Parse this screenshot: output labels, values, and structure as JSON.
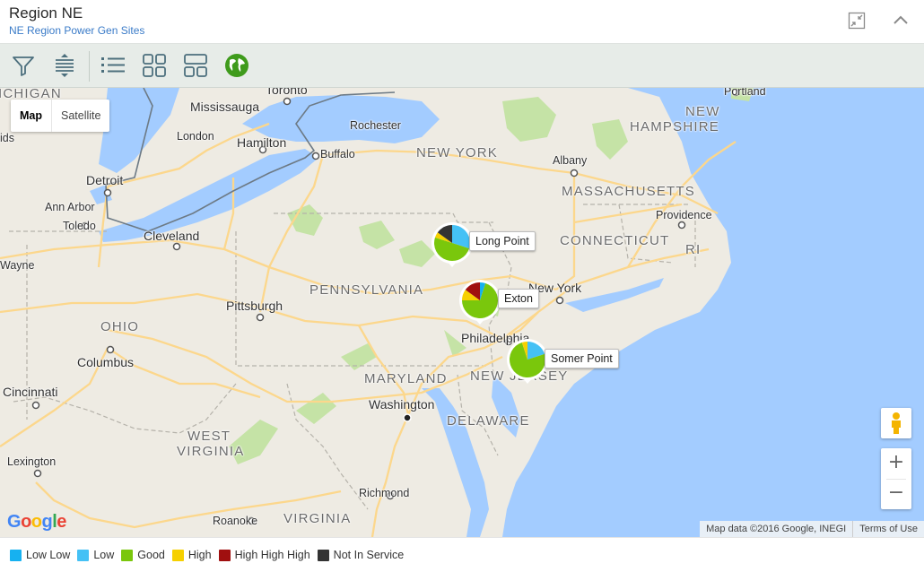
{
  "header": {
    "title": "Region NE",
    "subtitle": "NE Region Power Gen Sites"
  },
  "toolbar": {
    "buttons": [
      "filter-icon",
      "row-spacing-icon",
      "list-view-icon",
      "grid-view-icon",
      "split-view-icon",
      "globe-map-icon"
    ]
  },
  "map": {
    "map_type": {
      "map": "Map",
      "satellite": "Satellite"
    },
    "states": {
      "michigan": "ICHIGAN",
      "new_york": "NEW YORK",
      "massachusetts": "MASSACHUSETTS",
      "new_hampshire_1": "NEW",
      "new_hampshire_2": "HAMPSHIRE",
      "connecticut": "CONNECTICUT",
      "ri": "RI",
      "pennsylvania": "PENNSYLVANIA",
      "ohio": "OHIO",
      "maryland": "MARYLAND",
      "new_jersey": "NEW JERSEY",
      "delaware": "DELAWARE",
      "west_virginia_1": "WEST",
      "west_virginia_2": "VIRGINIA",
      "virginia": "VIRGINIA"
    },
    "cities": {
      "toronto": "Toronto",
      "mississauga": "Mississauga",
      "portland": "Portland",
      "rochester": "Rochester",
      "london": "London",
      "hamilton": "Hamilton",
      "buffalo": "Buffalo",
      "albany": "Albany",
      "ids": "ids",
      "detroit": "Detroit",
      "ann_arbor": "Ann Arbor",
      "toledo": "Toledo",
      "cleveland": "Cleveland",
      "providence": "Providence",
      "wayne": "Wayne",
      "pittsburgh": "Pittsburgh",
      "new_york": "New York",
      "philadelphia": "Philadelphia",
      "columbus": "Columbus",
      "cincinnati": "Cincinnati",
      "washington": "Washington",
      "lexington": "Lexington",
      "richmond": "Richmond",
      "roanoke": "Roanoke"
    },
    "attribution": "Map data ©2016 Google, INEGI",
    "terms": "Terms of Use",
    "google_logo": [
      "G",
      "o",
      "o",
      "g",
      "l",
      "e"
    ],
    "zoom_in": "+",
    "zoom_out": "−"
  },
  "sites": [
    {
      "name": "Long Point",
      "status_share": {
        "Low Low": 0,
        "Low": 0.3,
        "Good": 0.5,
        "High": 0.05,
        "High High High": 0,
        "Not In Service": 0.15
      }
    },
    {
      "name": "Exton",
      "status_share": {
        "Low Low": 0.05,
        "Low": 0,
        "Good": 0.7,
        "High": 0.1,
        "High High High": 0.15,
        "Not In Service": 0
      }
    },
    {
      "name": "Somer Point",
      "status_share": {
        "Low Low": 0,
        "Low": 0.2,
        "Good": 0.75,
        "High": 0.05,
        "High High High": 0,
        "Not In Service": 0
      }
    }
  ],
  "legend": [
    {
      "label": "Low Low",
      "color": "#16b1f0"
    },
    {
      "label": "Low",
      "color": "#45c1f5"
    },
    {
      "label": "Good",
      "color": "#7ac70c"
    },
    {
      "label": "High",
      "color": "#f6d000"
    },
    {
      "label": "High High High",
      "color": "#a00f0f"
    },
    {
      "label": "Not In Service",
      "color": "#333333"
    }
  ],
  "colors": {
    "water": "#a3ccff",
    "land": "#eeebe3",
    "road": "#fcd78c",
    "forest": "#c5e3a6",
    "accent": "#3a7bc8"
  }
}
